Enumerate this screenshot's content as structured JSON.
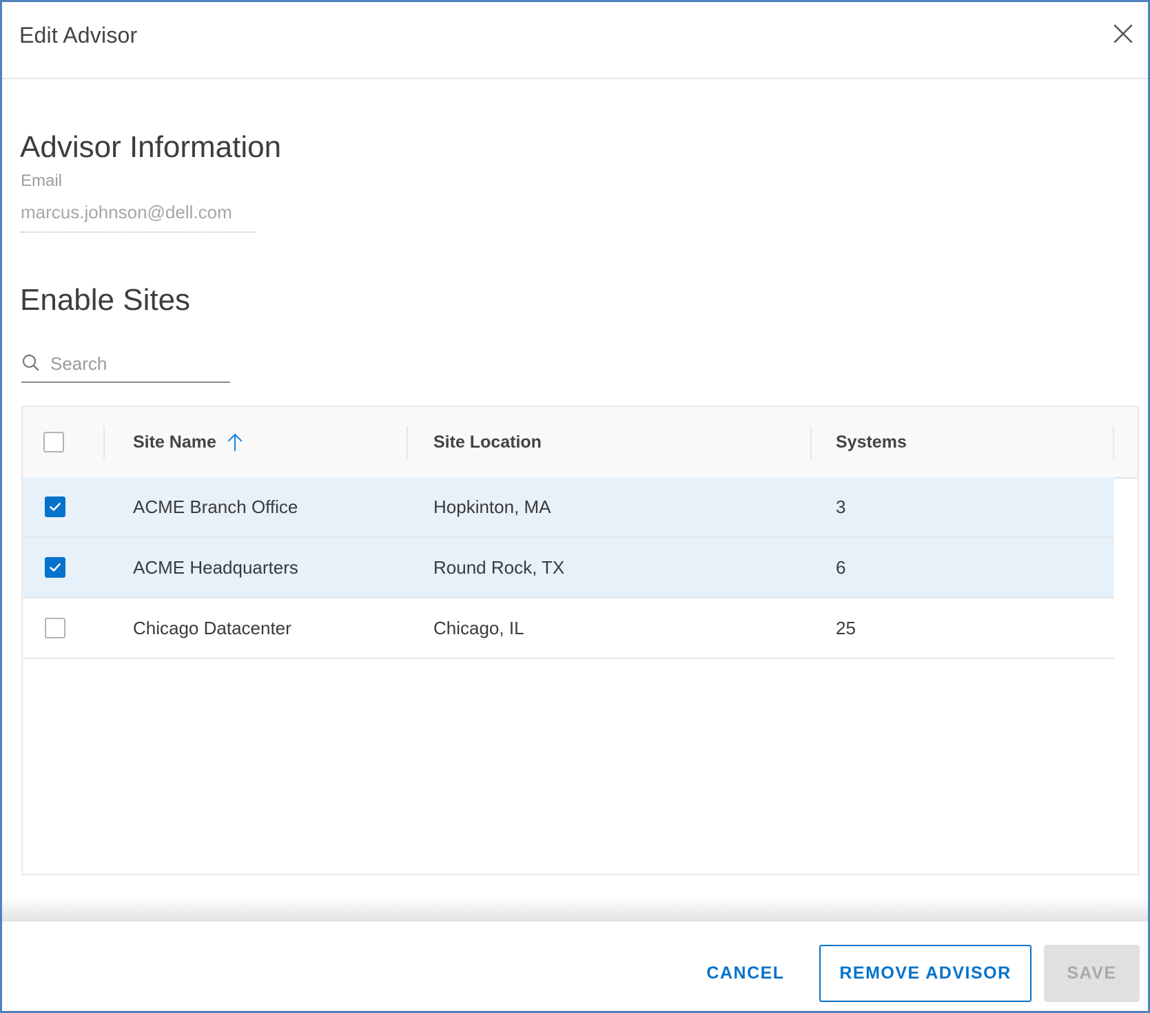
{
  "dialog": {
    "title": "Edit Advisor",
    "close_icon": "close-icon"
  },
  "advisor_info": {
    "heading": "Advisor Information",
    "email_label": "Email",
    "email_value": "marcus.johnson@dell.com"
  },
  "enable_sites": {
    "heading": "Enable Sites",
    "search": {
      "placeholder": "Search",
      "value": "",
      "icon": "search-icon"
    },
    "table": {
      "select_all_checked": false,
      "columns": [
        {
          "label": "Site Name",
          "sorted": "ascending",
          "sort_icon": "arrow-up-icon"
        },
        {
          "label": "Site Location"
        },
        {
          "label": "Systems"
        }
      ],
      "rows": [
        {
          "checked": true,
          "site_name": "ACME Branch Office",
          "site_location": "Hopkinton, MA",
          "systems": "3"
        },
        {
          "checked": true,
          "site_name": "ACME Headquarters",
          "site_location": "Round Rock, TX",
          "systems": "6"
        },
        {
          "checked": false,
          "site_name": "Chicago Datacenter",
          "site_location": "Chicago, IL",
          "systems": "25"
        }
      ]
    }
  },
  "footer": {
    "cancel_label": "CANCEL",
    "remove_label": "REMOVE ADVISOR",
    "save_label": "SAVE",
    "save_disabled": true
  },
  "colors": {
    "accent": "#0672cb",
    "selected_row": "#e7f1fa",
    "frame_border": "#4f81bd",
    "disabled_bg": "#e0e0e0"
  }
}
